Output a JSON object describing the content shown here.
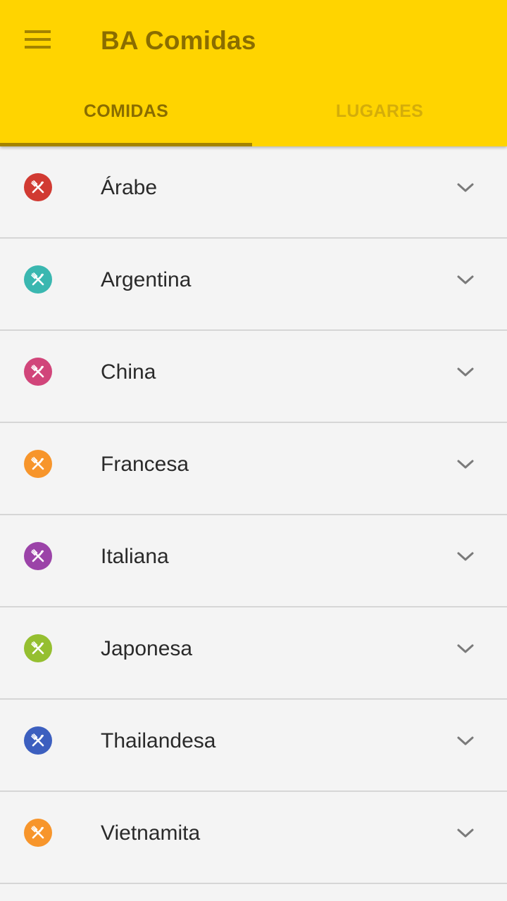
{
  "app": {
    "title": "BA Comidas",
    "menu_icon": "hamburger-menu-icon",
    "accent_color": "#ffd400"
  },
  "tabs": [
    {
      "label": "COMIDAS",
      "active": true
    },
    {
      "label": "LUGARES",
      "active": false
    }
  ],
  "categories": [
    {
      "label": "Árabe",
      "color": "#d13a32",
      "icon": "restaurant-icon"
    },
    {
      "label": "Argentina",
      "color": "#3ab7b0",
      "icon": "restaurant-icon"
    },
    {
      "label": "China",
      "color": "#d1457a",
      "icon": "restaurant-icon"
    },
    {
      "label": "Francesa",
      "color": "#f7952b",
      "icon": "restaurant-icon"
    },
    {
      "label": "Italiana",
      "color": "#9b43a8",
      "icon": "restaurant-icon"
    },
    {
      "label": "Japonesa",
      "color": "#95bf30",
      "icon": "restaurant-icon"
    },
    {
      "label": "Thailandesa",
      "color": "#3c5fbf",
      "icon": "restaurant-icon"
    },
    {
      "label": "Vietnamita",
      "color": "#f7952b",
      "icon": "restaurant-icon"
    }
  ]
}
